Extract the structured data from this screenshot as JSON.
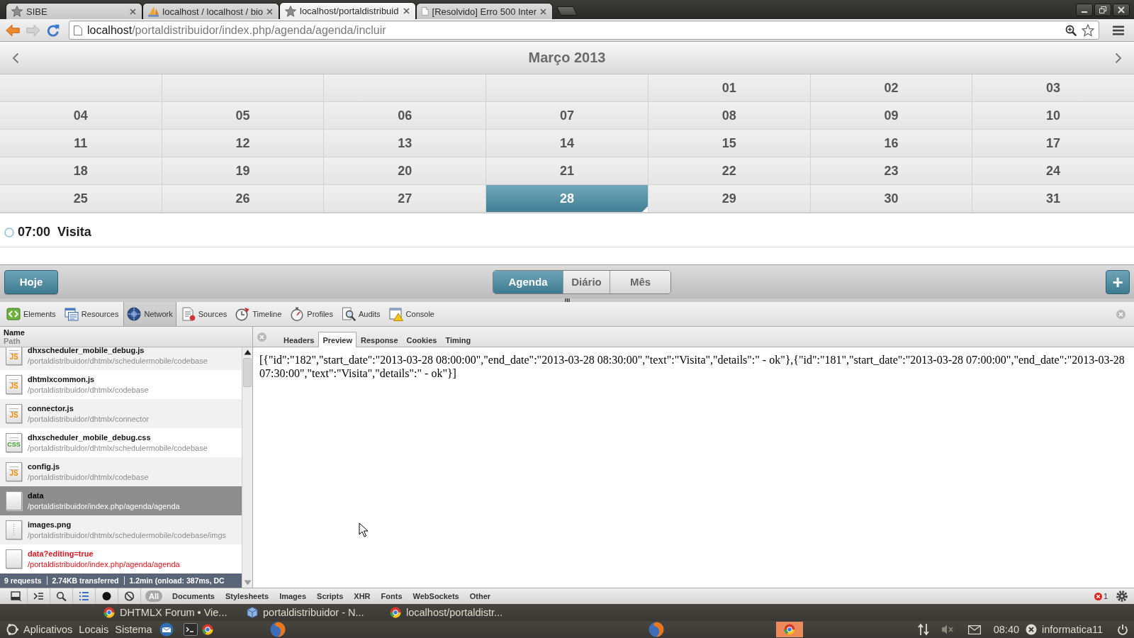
{
  "browser": {
    "tabs": [
      {
        "kind": "star",
        "title": "SIBE",
        "selected": false
      },
      {
        "kind": "pma",
        "title": "localhost / localhost / bio",
        "selected": false
      },
      {
        "kind": "star",
        "title": "localhost/portaldistribuid",
        "selected": true
      },
      {
        "kind": "page",
        "title": "[Resolvido] Erro 500 Inter",
        "selected": false
      }
    ],
    "address": {
      "host": "localhost",
      "path": "/portaldistribuidor/index.php/agenda/agenda/incluir"
    }
  },
  "calendar": {
    "title": "Março 2013",
    "weeks": [
      [
        {
          "kind": "blank"
        },
        {
          "kind": "blank"
        },
        {
          "kind": "blank"
        },
        {
          "kind": "blank"
        },
        {
          "kind": "day",
          "label": "01",
          "selected": false,
          "marked": false
        },
        {
          "kind": "day",
          "label": "02",
          "selected": false,
          "marked": false
        },
        {
          "kind": "day",
          "label": "03",
          "selected": false,
          "marked": false
        }
      ],
      [
        {
          "kind": "day",
          "label": "04",
          "selected": false,
          "marked": false
        },
        {
          "kind": "day",
          "label": "05",
          "selected": false,
          "marked": false
        },
        {
          "kind": "day",
          "label": "06",
          "selected": false,
          "marked": false
        },
        {
          "kind": "day",
          "label": "07",
          "selected": false,
          "marked": false
        },
        {
          "kind": "day",
          "label": "08",
          "selected": false,
          "marked": false
        },
        {
          "kind": "day",
          "label": "09",
          "selected": false,
          "marked": false
        },
        {
          "kind": "day",
          "label": "10",
          "selected": false,
          "marked": false
        }
      ],
      [
        {
          "kind": "day",
          "label": "11",
          "selected": false,
          "marked": false
        },
        {
          "kind": "day",
          "label": "12",
          "selected": false,
          "marked": false
        },
        {
          "kind": "day",
          "label": "13",
          "selected": false,
          "marked": false
        },
        {
          "kind": "day",
          "label": "14",
          "selected": false,
          "marked": false
        },
        {
          "kind": "day",
          "label": "15",
          "selected": false,
          "marked": false
        },
        {
          "kind": "day",
          "label": "16",
          "selected": false,
          "marked": false
        },
        {
          "kind": "day",
          "label": "17",
          "selected": false,
          "marked": false
        }
      ],
      [
        {
          "kind": "day",
          "label": "18",
          "selected": false,
          "marked": false
        },
        {
          "kind": "day",
          "label": "19",
          "selected": false,
          "marked": false
        },
        {
          "kind": "day",
          "label": "20",
          "selected": false,
          "marked": false
        },
        {
          "kind": "day",
          "label": "21",
          "selected": false,
          "marked": false
        },
        {
          "kind": "day",
          "label": "22",
          "selected": false,
          "marked": false
        },
        {
          "kind": "day",
          "label": "23",
          "selected": false,
          "marked": false
        },
        {
          "kind": "day",
          "label": "24",
          "selected": false,
          "marked": false
        }
      ],
      [
        {
          "kind": "day",
          "label": "25",
          "selected": false,
          "marked": false
        },
        {
          "kind": "day",
          "label": "26",
          "selected": false,
          "marked": false
        },
        {
          "kind": "day",
          "label": "27",
          "selected": false,
          "marked": false
        },
        {
          "kind": "day",
          "label": "28",
          "selected": true,
          "marked": true
        },
        {
          "kind": "day",
          "label": "29",
          "selected": false,
          "marked": false
        },
        {
          "kind": "day",
          "label": "30",
          "selected": false,
          "marked": false
        },
        {
          "kind": "day",
          "label": "31",
          "selected": false,
          "marked": false
        }
      ]
    ]
  },
  "events": [
    {
      "time": "07:00",
      "title": "Visita"
    }
  ],
  "scheduler_toolbar": {
    "today": "Hoje",
    "views": [
      {
        "label": "Agenda",
        "selected": true
      },
      {
        "label": "Diário",
        "selected": false
      },
      {
        "label": "Mês",
        "selected": false
      }
    ],
    "add": "+"
  },
  "devtools": {
    "panels": [
      {
        "kind": "elements",
        "label": "Elements",
        "selected": false
      },
      {
        "kind": "resources",
        "label": "Resources",
        "selected": false
      },
      {
        "kind": "network",
        "label": "Network",
        "selected": true
      },
      {
        "kind": "sources",
        "label": "Sources",
        "selected": false
      },
      {
        "kind": "timeline",
        "label": "Timeline",
        "selected": false
      },
      {
        "kind": "profiles",
        "label": "Profiles",
        "selected": false
      },
      {
        "kind": "audits",
        "label": "Audits",
        "selected": false
      },
      {
        "kind": "console",
        "label": "Console",
        "selected": false
      }
    ],
    "network": {
      "columns": {
        "name": "Name",
        "path": "Path"
      },
      "requests": [
        {
          "kind": "script",
          "icon_label": "JS",
          "name": "dhxscheduler_mobile_debug.js",
          "path": "/portaldistribuidor/dhtmlx/schedulermobile/codebase",
          "selected": false,
          "failed": false
        },
        {
          "kind": "script",
          "icon_label": "JS",
          "name": "dhtmlxcommon.js",
          "path": "/portaldistribuidor/dhtmlx/codebase",
          "selected": false,
          "failed": false
        },
        {
          "kind": "script",
          "icon_label": "JS",
          "name": "connector.js",
          "path": "/portaldistribuidor/dhtmlx/connector",
          "selected": false,
          "failed": false
        },
        {
          "kind": "stylesheet",
          "icon_label": "CSS",
          "name": "dhxscheduler_mobile_debug.css",
          "path": "/portaldistribuidor/dhtmlx/schedulermobile/codebase",
          "selected": false,
          "failed": false
        },
        {
          "kind": "script",
          "icon_label": "JS",
          "name": "config.js",
          "path": "/portaldistribuidor/dhtmlx/codebase",
          "selected": false,
          "failed": false
        },
        {
          "kind": "document",
          "name": "data",
          "path": "/portaldistribuidor/index.php/agenda/agenda",
          "selected": true,
          "failed": false
        },
        {
          "kind": "image",
          "name": "images.png",
          "path": "/portaldistribuidor/dhtmlx/schedulermobile/codebase/imgs",
          "selected": false,
          "failed": false
        },
        {
          "kind": "document",
          "name": "data?editing=true",
          "path": "/portaldistribuidor/index.php/agenda/agenda",
          "selected": false,
          "failed": true
        }
      ],
      "summary": [
        "9 requests",
        "2.74KB transferred",
        "1.2min (onload: 387ms, DC"
      ]
    },
    "detail_tabs": [
      {
        "label": "Headers",
        "selected": false
      },
      {
        "label": "Preview",
        "selected": true
      },
      {
        "label": "Response",
        "selected": false
      },
      {
        "label": "Cookies",
        "selected": false
      },
      {
        "label": "Timing",
        "selected": false
      }
    ],
    "preview": "[{\"id\":\"182\",\"start_date\":\"2013-03-28 08:00:00\",\"end_date\":\"2013-03-28 08:30:00\",\"text\":\"Visita\",\"details\":\" - ok\"},{\"id\":\"181\",\"start_date\":\"2013-03-28 07:00:00\",\"end_date\":\"2013-03-28 07:30:00\",\"text\":\"Visita\",\"details\":\" - ok\"}]",
    "filters": [
      {
        "label": "All",
        "selected": true
      },
      {
        "label": "Documents",
        "selected": false
      },
      {
        "label": "Stylesheets",
        "selected": false
      },
      {
        "label": "Images",
        "selected": false
      },
      {
        "label": "Scripts",
        "selected": false
      },
      {
        "label": "XHR",
        "selected": false
      },
      {
        "label": "Fonts",
        "selected": false
      },
      {
        "label": "WebSockets",
        "selected": false
      },
      {
        "label": "Other",
        "selected": false
      }
    ],
    "error_count": "1"
  },
  "taskbar": {
    "windows": [
      {
        "kind": "browser",
        "title": "DHTMLX Forum • Vie..."
      },
      {
        "kind": "cube",
        "title": "portaldistribuidor - N..."
      },
      {
        "kind": "browser",
        "title": "localhost/portaldistr..."
      }
    ]
  },
  "panel": {
    "menus": [
      "Aplicativos",
      "Locais",
      "Sistema"
    ],
    "clock": "08:40",
    "user": "informatica11"
  }
}
